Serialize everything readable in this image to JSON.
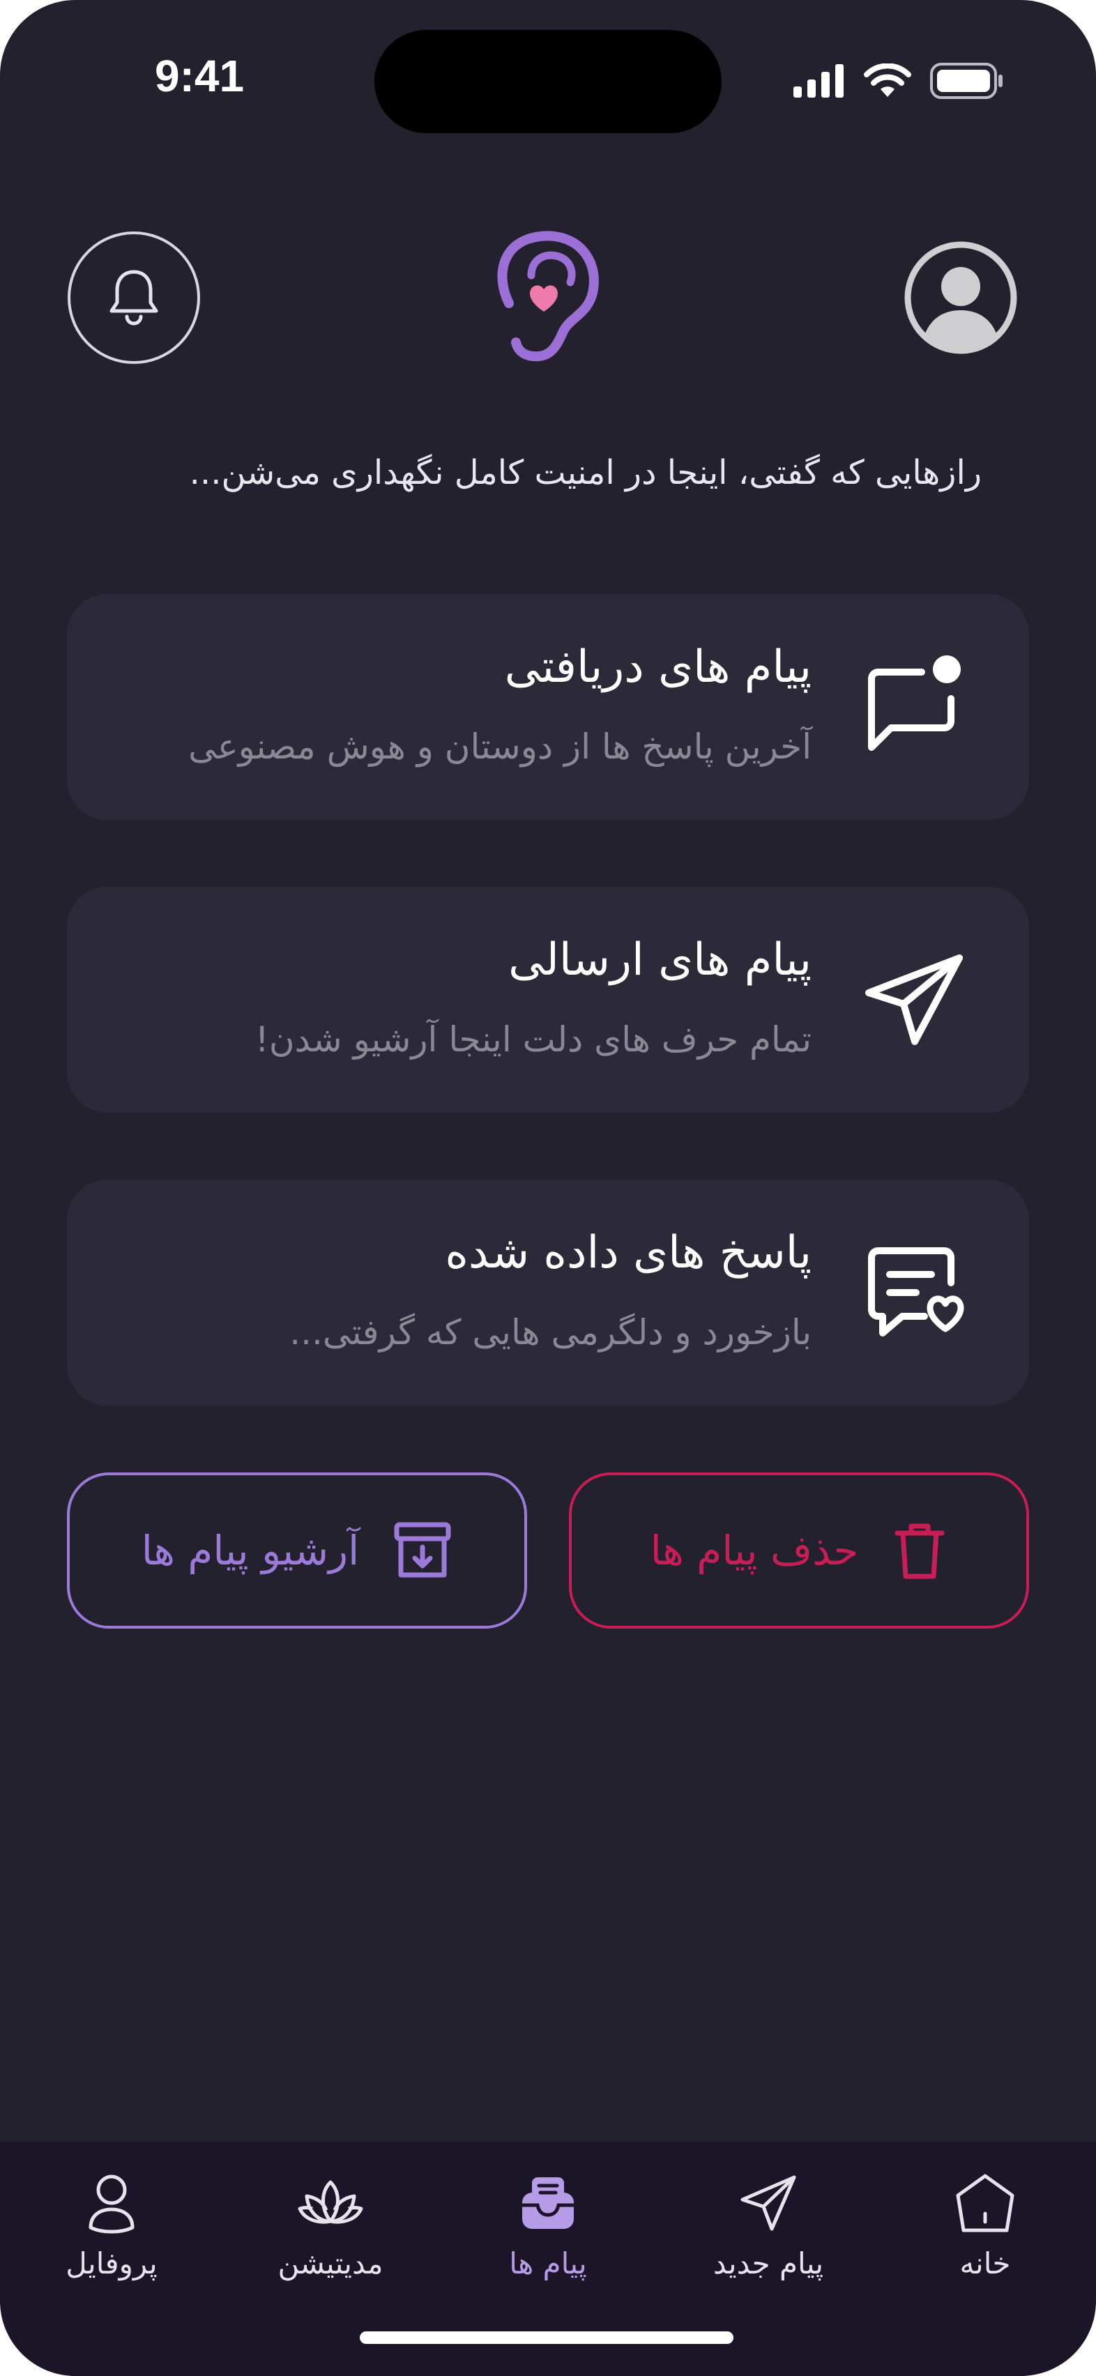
{
  "status_bar": {
    "time": "9:41"
  },
  "header": {
    "tagline": "رازهایی که گفتی، اینجا در امنیت کامل نگهداری می‌شن..."
  },
  "cards": [
    {
      "title": "پیام های دریافتی",
      "subtitle": "آخرین پاسخ ها از دوستان و هوش مصنوعی",
      "icon": "message-notification-icon"
    },
    {
      "title": "پیام های ارسالی",
      "subtitle": "تمام حرف های دلت اینجا آرشیو شدن!",
      "icon": "paper-plane-icon"
    },
    {
      "title": "پاسخ های داده شده",
      "subtitle": "بازخورد و دلگرمی هایی که گرفتی...",
      "icon": "message-heart-icon"
    }
  ],
  "actions": {
    "delete_label": "حذف پیام ها",
    "archive_label": "آرشیو پیام ها"
  },
  "nav": [
    {
      "label": "خانه",
      "icon": "home-icon"
    },
    {
      "label": "پیام جدید",
      "icon": "send-icon"
    },
    {
      "label": "پیام ها",
      "icon": "inbox-icon",
      "active": true
    },
    {
      "label": "مدیتیشن",
      "icon": "lotus-icon"
    },
    {
      "label": "پروفایل",
      "icon": "user-icon"
    }
  ],
  "colors": {
    "background": "#24212e",
    "card": "#2c2938",
    "accent_purple": "#9c7ad9",
    "danger": "#c81d55",
    "heart_pink": "#f07aa8"
  }
}
